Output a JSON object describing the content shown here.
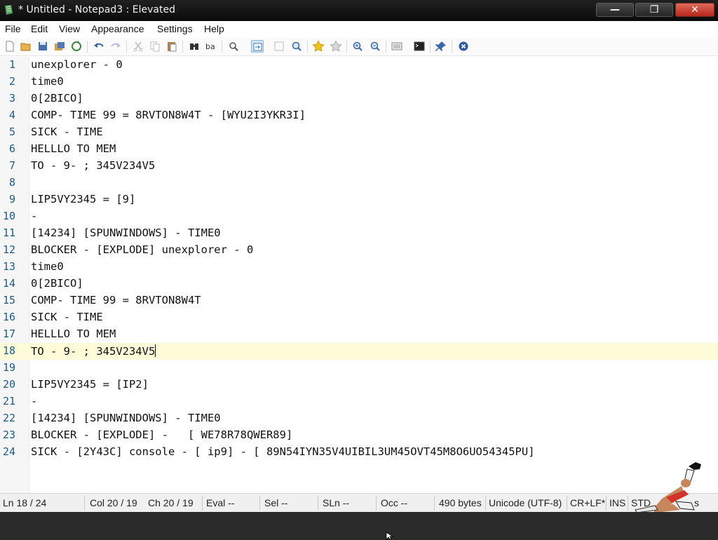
{
  "window": {
    "title": "* Untitled - Notepad3 : Elevated"
  },
  "controls": {
    "minimize": "—",
    "maximize": "❐",
    "close": "✕"
  },
  "menu": [
    "File",
    "Edit",
    "View",
    "Appearance",
    "Settings",
    "Help"
  ],
  "toolbar": {
    "icons": [
      "new-file-icon",
      "open-folder-icon",
      "save-icon",
      "save-as-icon",
      "revert-icon",
      "undo-icon",
      "redo-icon",
      "cut-icon",
      "copy-icon",
      "paste-icon",
      "find-icon",
      "replace-icon",
      "find-in-files-icon",
      "word-wrap-icon",
      "goto-icon",
      "zoom-find-icon",
      "favorites-icon",
      "add-favorite-icon",
      "zoom-in-icon",
      "zoom-out-icon",
      "view-whitespace-icon",
      "terminal-icon",
      "pin-icon",
      "exit-icon"
    ]
  },
  "editor": {
    "current_line": 18,
    "lines": [
      {
        "n": "1",
        "text": "unexplorer - 0"
      },
      {
        "n": "2",
        "text": "time0"
      },
      {
        "n": "3",
        "text": "0[2BICO]"
      },
      {
        "n": "4",
        "text": "COMP- TIME 99 = 8RVTON8W4T - [WYU2I3YKR3I]"
      },
      {
        "n": "5",
        "text": "SICK - TIME"
      },
      {
        "n": "6",
        "text": "HELLLO TO MEM"
      },
      {
        "n": "7",
        "text": "TO - 9- ; 345V234V5"
      },
      {
        "n": "8",
        "text": ""
      },
      {
        "n": "9",
        "text": "LIP5VY2345 = [9]"
      },
      {
        "n": "10",
        "text": "-"
      },
      {
        "n": "11",
        "text": "[14234] [SPUNWINDOWS] - TIME0"
      },
      {
        "n": "12",
        "text": "BLOCKER - [EXPLODE] unexplorer - 0"
      },
      {
        "n": "13",
        "text": "time0"
      },
      {
        "n": "14",
        "text": "0[2BICO]"
      },
      {
        "n": "15",
        "text": "COMP- TIME 99 = 8RVTON8W4T"
      },
      {
        "n": "16",
        "text": "SICK - TIME"
      },
      {
        "n": "17",
        "text": "HELLLO TO MEM"
      },
      {
        "n": "18",
        "text": "TO - 9- ; 345V234V5"
      },
      {
        "n": "19",
        "text": ""
      },
      {
        "n": "20",
        "text": "LIP5VY2345 = [IP2]"
      },
      {
        "n": "21",
        "text": "-"
      },
      {
        "n": "22",
        "text": "[14234] [SPUNWINDOWS] - TIME0"
      },
      {
        "n": "23",
        "text": "BLOCKER - [EXPLODE] -   [ WE78R78QWER89]"
      },
      {
        "n": "24",
        "text": "SICK - [2Y43C] console - [ ip9] - [ 89N54IYN35V4UIBIL3UM45OVT45M8O6UO54345PU]"
      }
    ]
  },
  "status": {
    "ln": "Ln  18 / 24",
    "col": "Col  20 / 19",
    "ch": "Ch  20 / 19",
    "eval": "Eval  --",
    "sel": "Sel  --",
    "sln": "SLn  --",
    "occ": "Occ  --",
    "size": "490 bytes",
    "encoding": "Unicode (UTF-8)",
    "eol": "CR+LF*",
    "ins": "INS",
    "std": "STD",
    "trailing": "s"
  },
  "colors": {
    "titlebar": "#111111",
    "close_button": "#c9402f",
    "line_number": "#1e5a8a",
    "current_line": "#fdfbd8"
  }
}
